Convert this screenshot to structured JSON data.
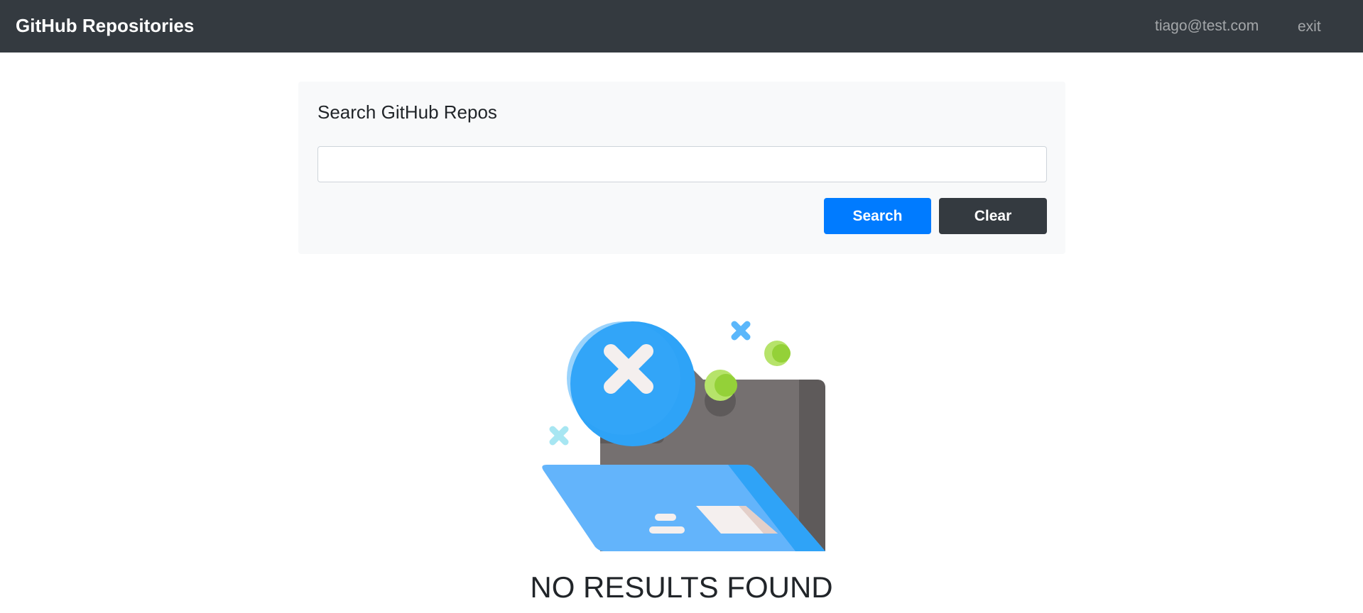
{
  "navbar": {
    "brand": "GitHub Repositories",
    "user_email": "tiago@test.com",
    "exit_label": "exit"
  },
  "search": {
    "title": "Search GitHub Repos",
    "input_value": "",
    "placeholder": "",
    "search_label": "Search",
    "clear_label": "Clear"
  },
  "empty_state": {
    "message": "NO RESULTS FOUND",
    "illustration": "no-results-folder-icon"
  },
  "colors": {
    "navbar_bg": "#343a40",
    "primary": "#007bff",
    "dark": "#343a40",
    "card_bg": "#f8f9fa"
  }
}
